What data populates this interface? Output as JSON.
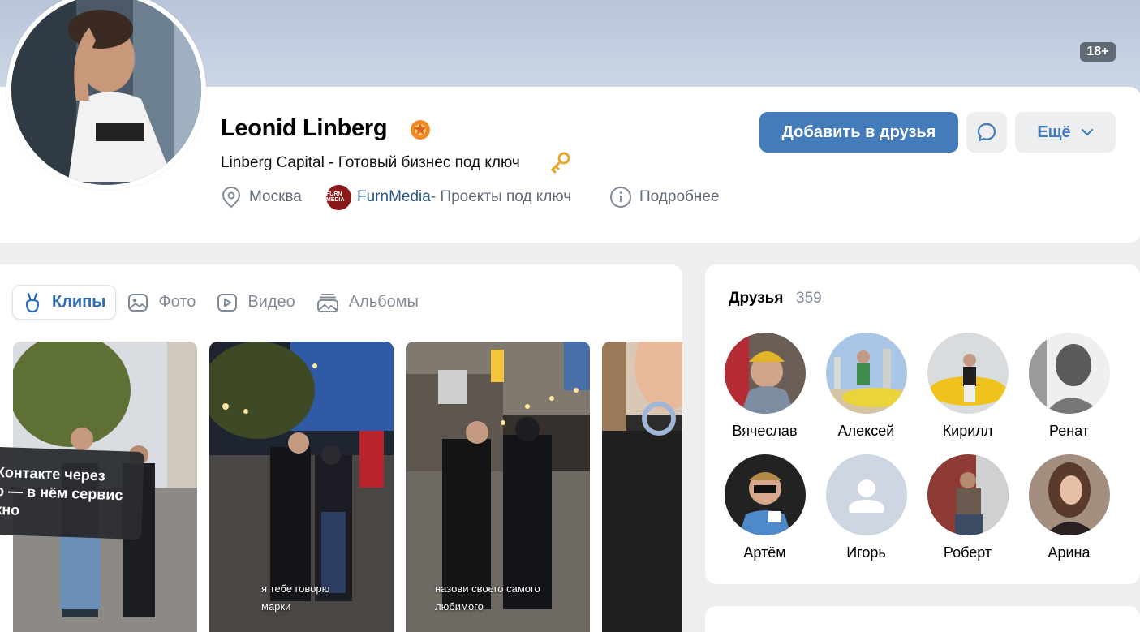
{
  "header": {
    "age_badge": "18+"
  },
  "profile": {
    "name": "Leonid Linberg",
    "status": "Linberg Capital - Готовый бизнес под ключ",
    "city": "Москва",
    "work": {
      "name": "FurnMedia",
      "suffix": " - Проекты под ключ",
      "logo_text": "FURN MEDIA"
    },
    "more_info": "Подробнее",
    "verify_icon": "verified-flame-icon",
    "status_icon": "key-icon"
  },
  "actions": {
    "add_friend": "Добавить в друзья",
    "more": "Ещё",
    "message_icon": "message-bubble-icon"
  },
  "media": {
    "tabs": [
      {
        "label": "Клипы",
        "icon": "clips-icon",
        "active": true
      },
      {
        "label": "Фото",
        "icon": "photo-icon",
        "active": false
      },
      {
        "label": "Видео",
        "icon": "video-icon",
        "active": false
      },
      {
        "label": "Альбомы",
        "icon": "albums-icon",
        "active": false
      }
    ],
    "tooltip_lines": [
      "Контакте через",
      "р — в нём сервис",
      "кно"
    ],
    "clips": [
      {
        "caption_lines": []
      },
      {
        "caption_lines": [
          "я тебе говорю",
          "марки"
        ]
      },
      {
        "caption_lines": [
          "назови своего самого",
          "любимого"
        ]
      },
      {
        "caption_lines": []
      }
    ]
  },
  "friends": {
    "title": "Друзья",
    "count": "359",
    "items": [
      {
        "name": "Вячеслав"
      },
      {
        "name": "Алексей"
      },
      {
        "name": "Кирилл"
      },
      {
        "name": "Ренат"
      },
      {
        "name": "Артём"
      },
      {
        "name": "Игорь"
      },
      {
        "name": "Роберт"
      },
      {
        "name": "Арина"
      }
    ]
  },
  "colors": {
    "accent": "#447bba",
    "link": "#2a5885",
    "secondary_text": "#626d7a",
    "page_bg": "#edeef0"
  }
}
